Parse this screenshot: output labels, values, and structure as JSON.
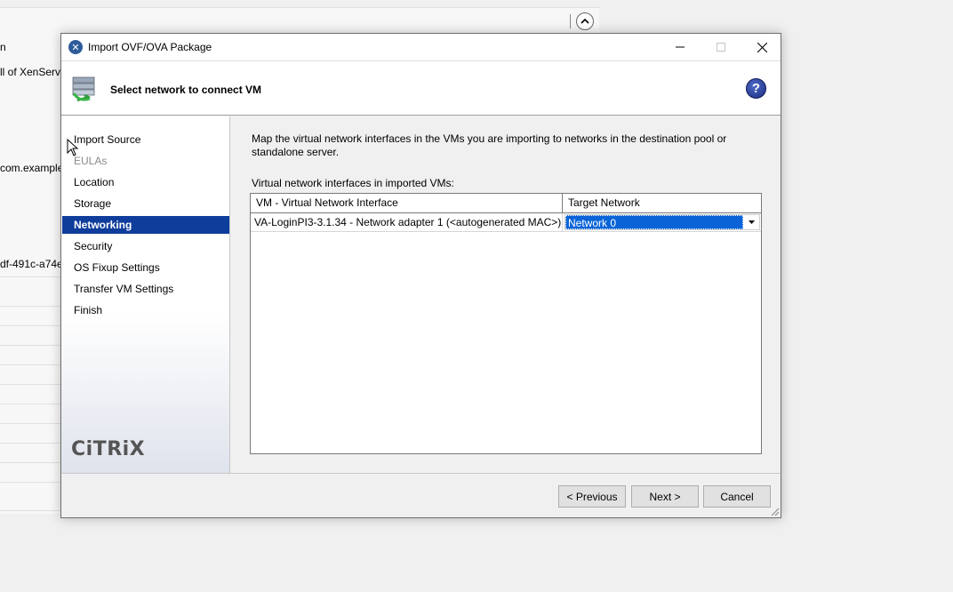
{
  "background": {
    "texts": [
      "n",
      "ll of XenServe",
      "com.example",
      "df-491c-a74e-"
    ]
  },
  "dialog": {
    "title": "Import OVF/OVA Package",
    "header_title": "Select network to connect VM",
    "help_label": "?",
    "controls": {
      "minimize": "—",
      "maximize": "☐",
      "close": "✕"
    }
  },
  "sidebar": {
    "items": [
      {
        "label": "Import Source",
        "state": "normal"
      },
      {
        "label": "EULAs",
        "state": "disabled"
      },
      {
        "label": "Location",
        "state": "normal"
      },
      {
        "label": "Storage",
        "state": "normal"
      },
      {
        "label": "Networking",
        "state": "active"
      },
      {
        "label": "Security",
        "state": "normal"
      },
      {
        "label": "OS Fixup Settings",
        "state": "normal"
      },
      {
        "label": "Transfer VM Settings",
        "state": "normal"
      },
      {
        "label": "Finish",
        "state": "normal"
      }
    ],
    "logo": "CiTRiX"
  },
  "content": {
    "description": "Map the virtual network interfaces in the VMs you are importing to networks in the destination pool or standalone server.",
    "list_label": "Virtual network interfaces in imported VMs:",
    "columns": [
      "VM - Virtual Network Interface",
      "Target Network"
    ],
    "rows": [
      {
        "interface": "VA-LoginPI3-3.1.34 - Network adapter 1 (<autogenerated MAC>)",
        "target": "Network 0"
      }
    ]
  },
  "footer": {
    "previous": "< Previous",
    "next": "Next >",
    "cancel": "Cancel"
  },
  "colors": {
    "active_nav": "#0f3d9c",
    "selection": "#0a64d8"
  }
}
